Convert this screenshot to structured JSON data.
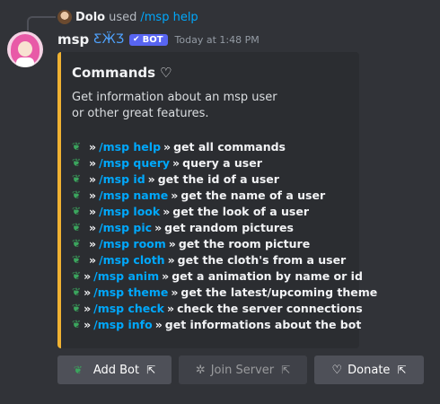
{
  "reply": {
    "username": "Dolo",
    "used": "used",
    "command": "/msp help"
  },
  "message": {
    "username": "msp",
    "bot_tag": "BOT",
    "timestamp": "Today at 1:48 PM"
  },
  "embed": {
    "title": "Commands",
    "description_line1": "Get information about an msp user",
    "description_line2": "or other great features.",
    "commands": [
      {
        "cmd": "/msp help",
        "desc": "get all commands"
      },
      {
        "cmd": "/msp query",
        "desc": "query a user"
      },
      {
        "cmd": "/msp id",
        "desc": "get the id of a user"
      },
      {
        "cmd": "/msp name",
        "desc": "get the name of a user"
      },
      {
        "cmd": "/msp look",
        "desc": "get the look of a user"
      },
      {
        "cmd": "/msp pic",
        "desc": "get random pictures"
      },
      {
        "cmd": "/msp room",
        "desc": "get the room picture"
      },
      {
        "cmd": "/msp cloth",
        "desc": "get the cloth's from a user"
      },
      {
        "cmd": "/msp anim",
        "desc": "get a animation by name or id"
      },
      {
        "cmd": "/msp theme",
        "desc": "get the latest/upcoming theme"
      },
      {
        "cmd": "/msp check",
        "desc": "check the server connections"
      },
      {
        "cmd": "/msp info",
        "desc": "get informations about the bot"
      }
    ],
    "separator": "»"
  },
  "buttons": [
    {
      "label": "Add Bot",
      "icon": "sprout-icon",
      "disabled": false
    },
    {
      "label": "Join Server",
      "icon": "server-icon",
      "disabled": true
    },
    {
      "label": "Donate",
      "icon": "heart-icon",
      "disabled": false
    }
  ],
  "colors": {
    "accent": "#f0b232",
    "link": "#00a8fc",
    "bot_tag": "#5865f2",
    "sprout": "#3ba55d"
  }
}
